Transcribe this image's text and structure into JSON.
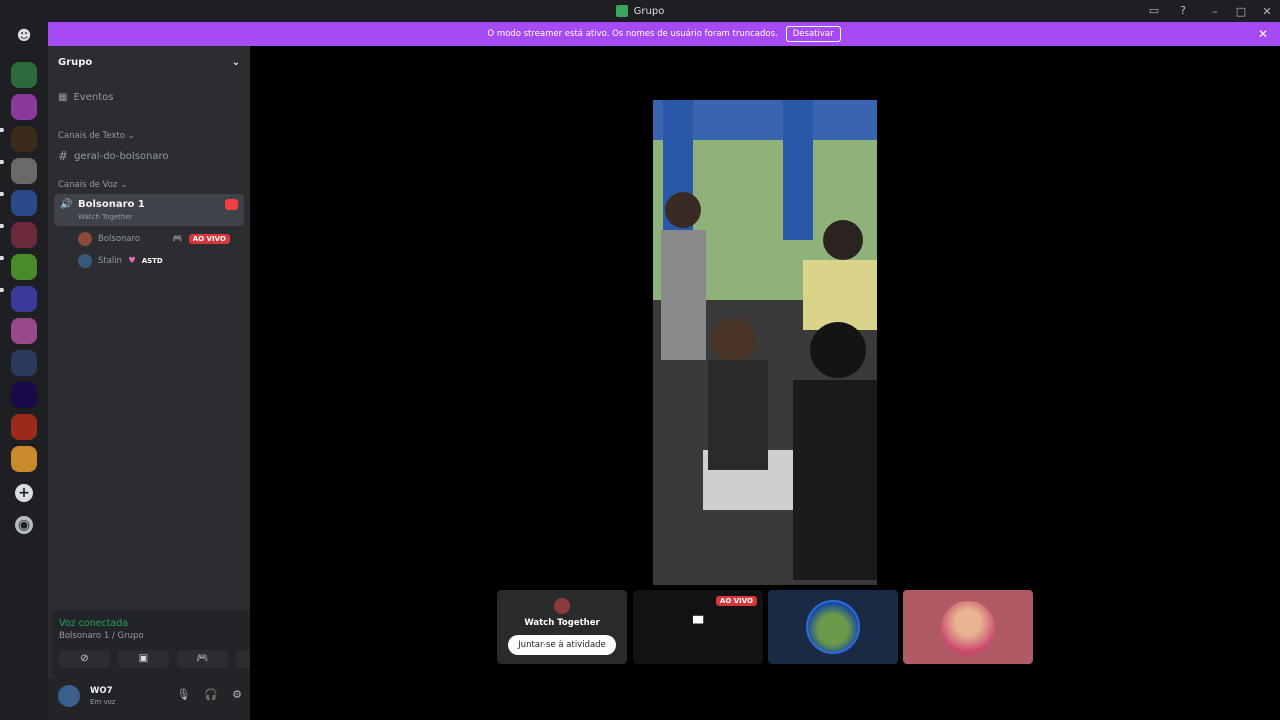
{
  "window": {
    "title": "Grupo"
  },
  "banner": {
    "message": "O modo streamer está ativo. Os nomes de usuário foram truncados.",
    "button": "Desativar"
  },
  "server": {
    "name": "Grupo",
    "events_label": "Eventos",
    "text_category": "Canais de Texto",
    "text_channel": "geral-do-bolsonaro",
    "voice_category": "Canais de Voz",
    "voice_channel": {
      "name": "Bolsonaro 1",
      "activity": "Watch Together"
    },
    "members": [
      {
        "name": "Bolsonaro",
        "badge": "AO VIVO"
      },
      {
        "name": "Stalin",
        "tag": "ASTD"
      }
    ]
  },
  "voice_panel": {
    "status": "Voz conectada",
    "location": "Bolsonaro 1 / Grupo"
  },
  "user": {
    "name": "WO7",
    "status": "Em voz"
  },
  "tiles": {
    "watch_together": "Watch Together",
    "join_button": "Juntar-se à atividade",
    "live_badge": "AO VIVO"
  },
  "colors": {
    "accent": "#a64bf4",
    "live": "#da373c",
    "connected": "#23a55a"
  }
}
